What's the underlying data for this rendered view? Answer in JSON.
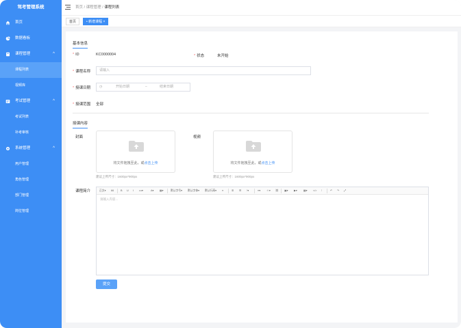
{
  "app": {
    "title": "驾考管理系统"
  },
  "sidebar": {
    "items": [
      {
        "label": "首页",
        "icon": "home-icon"
      },
      {
        "label": "数据看板",
        "icon": "pie-chart-icon"
      },
      {
        "label": "课程管理",
        "icon": "book-icon",
        "expanded": true,
        "children": [
          {
            "label": "课程列表",
            "active": true
          },
          {
            "label": "视频库"
          }
        ]
      },
      {
        "label": "考试管理",
        "icon": "exam-icon",
        "expanded": true,
        "children": [
          {
            "label": "考试列表"
          },
          {
            "label": "补考审核"
          }
        ]
      },
      {
        "label": "系统管理",
        "icon": "gear-icon",
        "expanded": true,
        "children": [
          {
            "label": "用户管理"
          },
          {
            "label": "角色管理"
          },
          {
            "label": "部门管理"
          },
          {
            "label": "岗位管理"
          }
        ]
      }
    ],
    "arrow_glyph": "^"
  },
  "header": {
    "breadcrumb": [
      "首页",
      "课程管理",
      "课程列表"
    ],
    "separator": "/"
  },
  "tabs": [
    {
      "label": "首页",
      "active": false
    },
    {
      "label": "• 新增课程",
      "active": true,
      "close": "×"
    }
  ],
  "form": {
    "basic_title": "基本信息",
    "id_label": "ID",
    "id_value": "KC0000004",
    "status_label": "状态",
    "status_value": "未开始",
    "name_label": "课程名称",
    "name_placeholder": "请输入",
    "date_label": "授课日期",
    "date_start_placeholder": "开始日期",
    "date_sep": "–",
    "date_end_placeholder": "结束日期",
    "range_label": "授课范围",
    "range_value": "全部",
    "required_mark": "*"
  },
  "content": {
    "title": "授课内容",
    "cover_label": "封面",
    "video_label": "视频",
    "upload_text": "将文件拖拽至此，或",
    "upload_link": "点击上传",
    "cover_hint": "建议上传尺寸：1600px*900px",
    "video_hint": "建议上传尺寸：1600px*900px",
    "intro_label": "课程简介",
    "editor_placeholder": "请输入内容..."
  },
  "editor_toolbar": [
    "正文▾",
    "66",
    "B",
    "U",
    "I",
    "•••▾",
    "A▾",
    "▦▾",
    "默认字号▾",
    "默认字体▾",
    "默认行高▾",
    "≡",
    "≣",
    "☰",
    "⁝▾",
    "≡▾",
    "☺▾",
    "⛓",
    "▣▾",
    "▶▾",
    "▦▾",
    "</>",
    "⁝",
    "↶",
    "↷",
    "⤢"
  ],
  "actions": {
    "submit_label": "提交"
  },
  "colors": {
    "primary": "#3d8ef5",
    "sidebar_active": "#5aa2f8",
    "required": "#f56c6c"
  }
}
